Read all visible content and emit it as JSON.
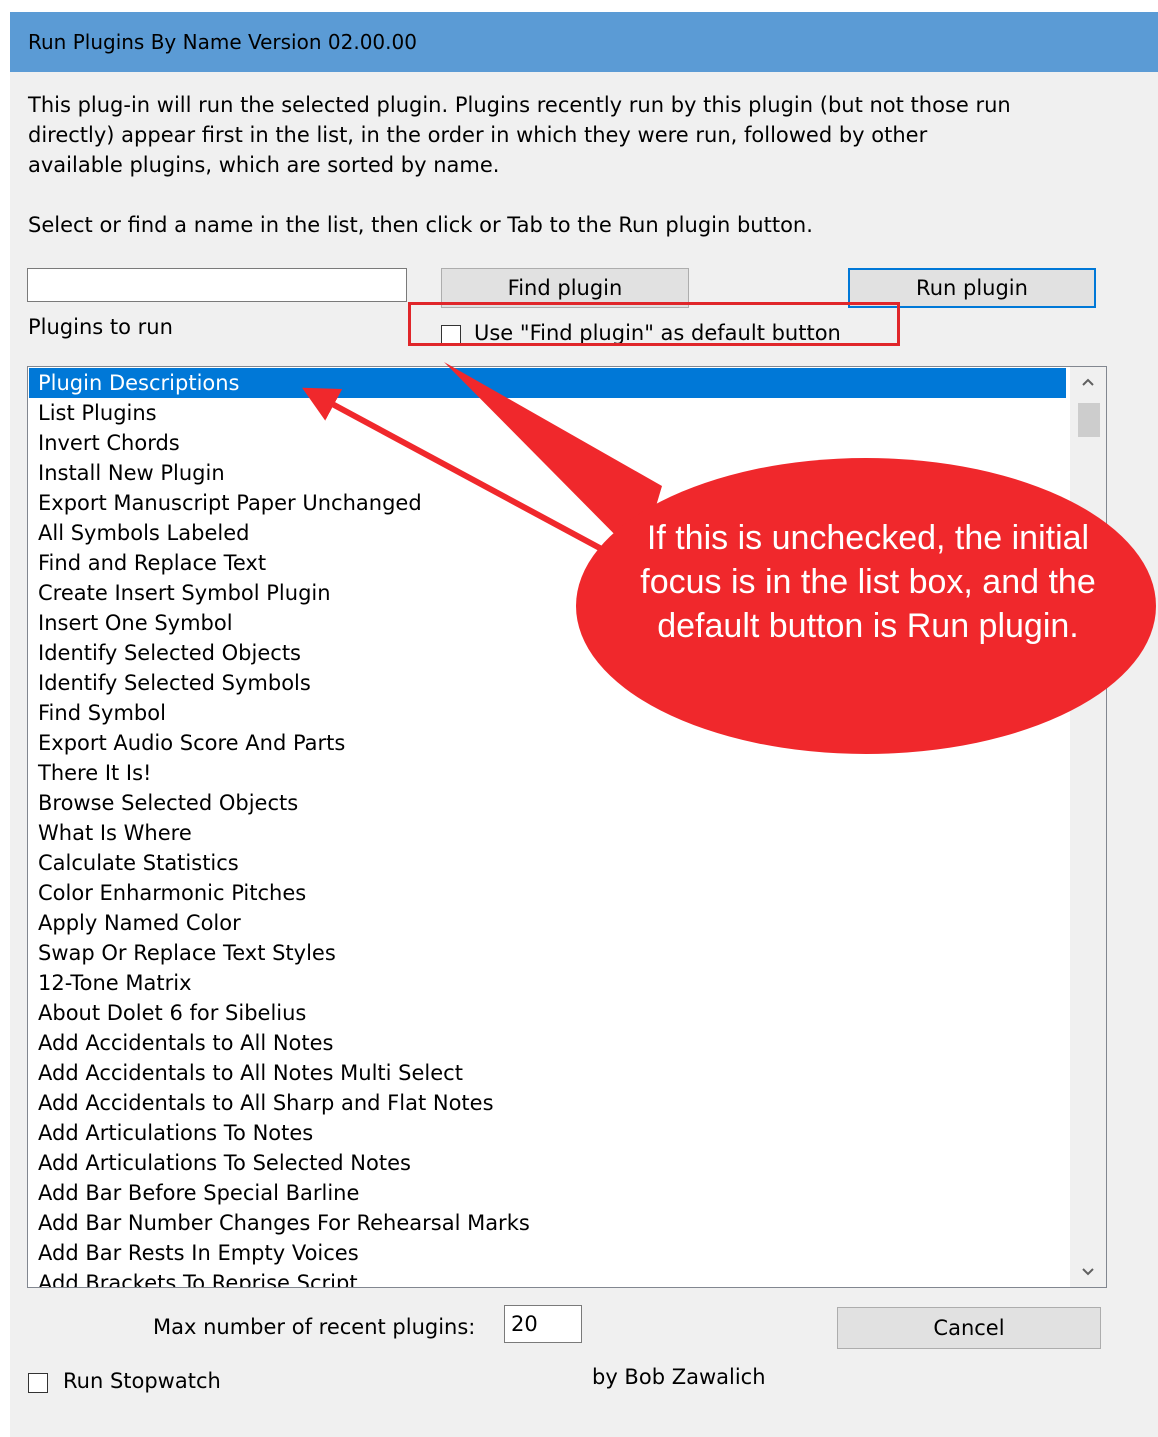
{
  "window": {
    "title": "Run Plugins By Name  Version 02.00.00"
  },
  "description": "This plug-in will run the selected plugin. Plugins recently run by this plugin (but not those run directly) appear first in the list, in the order in which they were run, followed by other available plugins, which are sorted by name.",
  "hint": "Select or find a name in the list, then click or Tab to the Run plugin button.",
  "search": {
    "value": ""
  },
  "buttons": {
    "find": "Find plugin",
    "run": "Run plugin",
    "cancel": "Cancel"
  },
  "plugins_label": "Plugins to run",
  "default_find_checkbox": {
    "label": "Use \"Find plugin\" as default button",
    "checked": false
  },
  "plugin_list": {
    "selected_index": 0,
    "items": [
      "Plugin Descriptions",
      "List Plugins",
      "Invert Chords",
      "Install New Plugin",
      "Export Manuscript Paper Unchanged",
      "All Symbols Labeled",
      "Find and Replace Text",
      "Create Insert Symbol Plugin",
      "Insert One Symbol",
      "Identify Selected Objects",
      "Identify Selected Symbols",
      "Find Symbol",
      "Export Audio Score And Parts",
      "There It Is!",
      "Browse Selected Objects",
      "What Is Where",
      "Calculate Statistics",
      "Color Enharmonic Pitches",
      "Apply Named Color",
      "Swap Or Replace Text Styles",
      "12-Tone Matrix",
      "About Dolet 6 for Sibelius",
      "Add Accidentals to All Notes",
      "Add Accidentals to All Notes Multi Select",
      "Add Accidentals to All Sharp and Flat Notes",
      "Add Articulations To Notes",
      "Add Articulations To Selected Notes",
      "Add Bar Before Special Barline",
      "Add Bar Number Changes For Rehearsal Marks",
      "Add Bar Rests In Empty Voices",
      "Add Brackets To Reprise Script"
    ]
  },
  "max_recent": {
    "label": "Max number of recent plugins:",
    "value": "20"
  },
  "stopwatch_checkbox": {
    "label": "Run Stopwatch",
    "checked": false
  },
  "credit": "by Bob Zawalich",
  "annotation": {
    "callout_text": "If this is unchecked, the initial focus is in the list box, and the default button is Run plugin.",
    "color": "#f0282c"
  },
  "colors": {
    "title_bar": "#5b9bd5",
    "selection": "#0078d7",
    "default_button_border": "#0078d7"
  },
  "icons": {
    "scroll_up": "chevron-up-icon",
    "scroll_down": "chevron-down-icon"
  }
}
